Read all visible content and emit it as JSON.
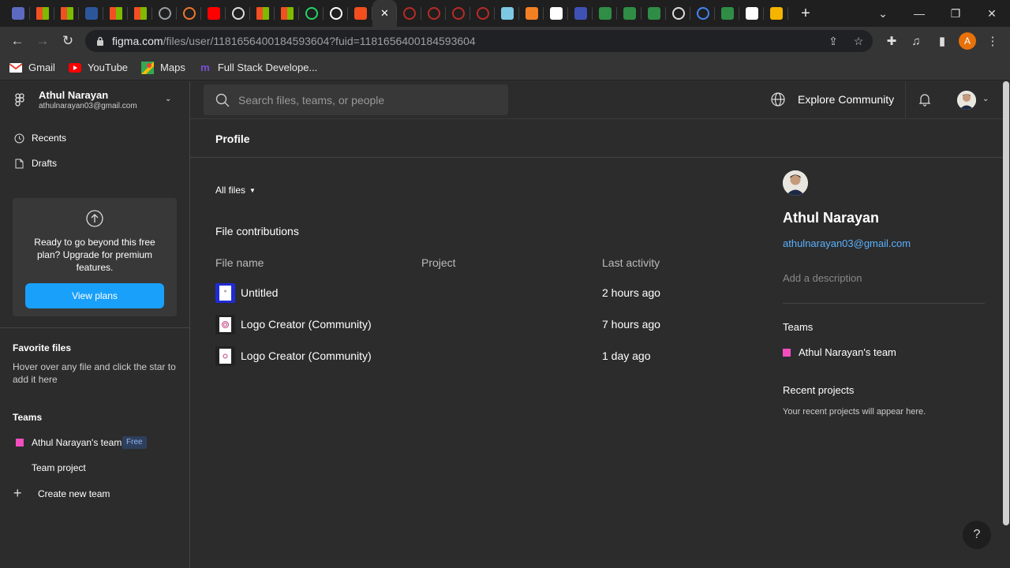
{
  "browser": {
    "tabs": [
      {
        "icon": "app-grid-icon",
        "color": "#5c6bc0"
      },
      {
        "icon": "microsoft-icon",
        "color": "#f25022"
      },
      {
        "icon": "microsoft-icon",
        "color": "#f25022"
      },
      {
        "icon": "word-icon",
        "color": "#2b579a"
      },
      {
        "icon": "microsoft-icon",
        "color": "#f25022"
      },
      {
        "icon": "microsoft-icon",
        "color": "#f25022"
      },
      {
        "icon": "globe-icon",
        "color": "#9aa0a6"
      },
      {
        "icon": "codepen-icon",
        "color": "#f0772b"
      },
      {
        "icon": "youtube-icon",
        "color": "#ff0000"
      },
      {
        "icon": "chrome-icon",
        "color": "#dddddd"
      },
      {
        "icon": "microsoft-icon",
        "color": "#f25022"
      },
      {
        "icon": "microsoft-icon",
        "color": "#f25022"
      },
      {
        "icon": "whatsapp-icon",
        "color": "#25d366"
      },
      {
        "icon": "github-icon",
        "color": "#ffffff"
      },
      {
        "icon": "figma-icon",
        "color": "#f24e1e"
      },
      {
        "icon": "close-icon",
        "color": "#ffffff",
        "active": true
      },
      {
        "icon": "quora-icon",
        "color": "#b92b27"
      },
      {
        "icon": "quora-icon",
        "color": "#b92b27"
      },
      {
        "icon": "quora-icon",
        "color": "#b92b27"
      },
      {
        "icon": "quora-icon",
        "color": "#b92b27"
      },
      {
        "icon": "mountain-icon",
        "color": "#7ec8e3"
      },
      {
        "icon": "stackoverflow-icon",
        "color": "#f48024"
      },
      {
        "icon": "hashnode-icon",
        "color": "#ffffff"
      },
      {
        "icon": "notion-icon",
        "color": "#3f51b5"
      },
      {
        "icon": "geeksforgeeks-icon",
        "color": "#2f8d46"
      },
      {
        "icon": "geeksforgeeks-icon",
        "color": "#2f8d46"
      },
      {
        "icon": "geeksforgeeks-icon",
        "color": "#2f8d46"
      },
      {
        "icon": "chrome-icon",
        "color": "#dddddd"
      },
      {
        "icon": "google-icon",
        "color": "#4285f4"
      },
      {
        "icon": "geeksforgeeks-icon",
        "color": "#2f8d46"
      },
      {
        "icon": "medium-icon",
        "color": "#ffffff"
      },
      {
        "icon": "diamond-icon",
        "color": "#f4b400"
      }
    ],
    "url_host": "figma.com",
    "url_path": "/files/user/1181656400184593604?fuid=1181656400184593604",
    "profile_initial": "A",
    "bookmarks": [
      {
        "label": "Gmail",
        "icon": "gmail-icon"
      },
      {
        "label": "YouTube",
        "icon": "youtube-icon"
      },
      {
        "label": "Maps",
        "icon": "maps-icon"
      },
      {
        "label": "Full Stack Develope...",
        "icon": "bookmark-m-icon"
      }
    ]
  },
  "account": {
    "name": "Athul Narayan",
    "email": "athulnarayan03@gmail.com"
  },
  "sidebar": {
    "nav": [
      {
        "label": "Recents",
        "icon": "clock-icon"
      },
      {
        "label": "Drafts",
        "icon": "file-icon"
      }
    ],
    "upgrade": {
      "text": "Ready to go beyond this free plan? Upgrade for premium features.",
      "button": "View plans"
    },
    "favorites_heading": "Favorite files",
    "favorites_text": "Hover over any file and click the star to add it here",
    "teams_heading": "Teams",
    "team_name": "Athul Narayan's team",
    "team_badge": "Free",
    "team_project": "Team project",
    "create_team": "Create new team"
  },
  "header": {
    "search_placeholder": "Search files, teams, or people",
    "explore": "Explore Community"
  },
  "main": {
    "title": "Profile",
    "filter": "All files",
    "section": "File contributions",
    "columns": [
      "File name",
      "Project",
      "Last activity"
    ],
    "files": [
      {
        "name": "Untitled",
        "project": "",
        "activity": "2 hours ago"
      },
      {
        "name": "Logo Creator (Community)",
        "project": "",
        "activity": "7 hours ago"
      },
      {
        "name": "Logo Creator (Community)",
        "project": "",
        "activity": "1 day ago"
      }
    ]
  },
  "profile": {
    "name": "Athul Narayan",
    "email": "athulnarayan03@gmail.com",
    "description_placeholder": "Add a description",
    "teams_heading": "Teams",
    "team": "Athul Narayan's team",
    "recent_heading": "Recent projects",
    "recent_text": "Your recent projects will appear here."
  },
  "colors": {
    "accent": "#18a0fb",
    "team": "#f24ebf",
    "link": "#5ab1ff"
  },
  "help_label": "?"
}
